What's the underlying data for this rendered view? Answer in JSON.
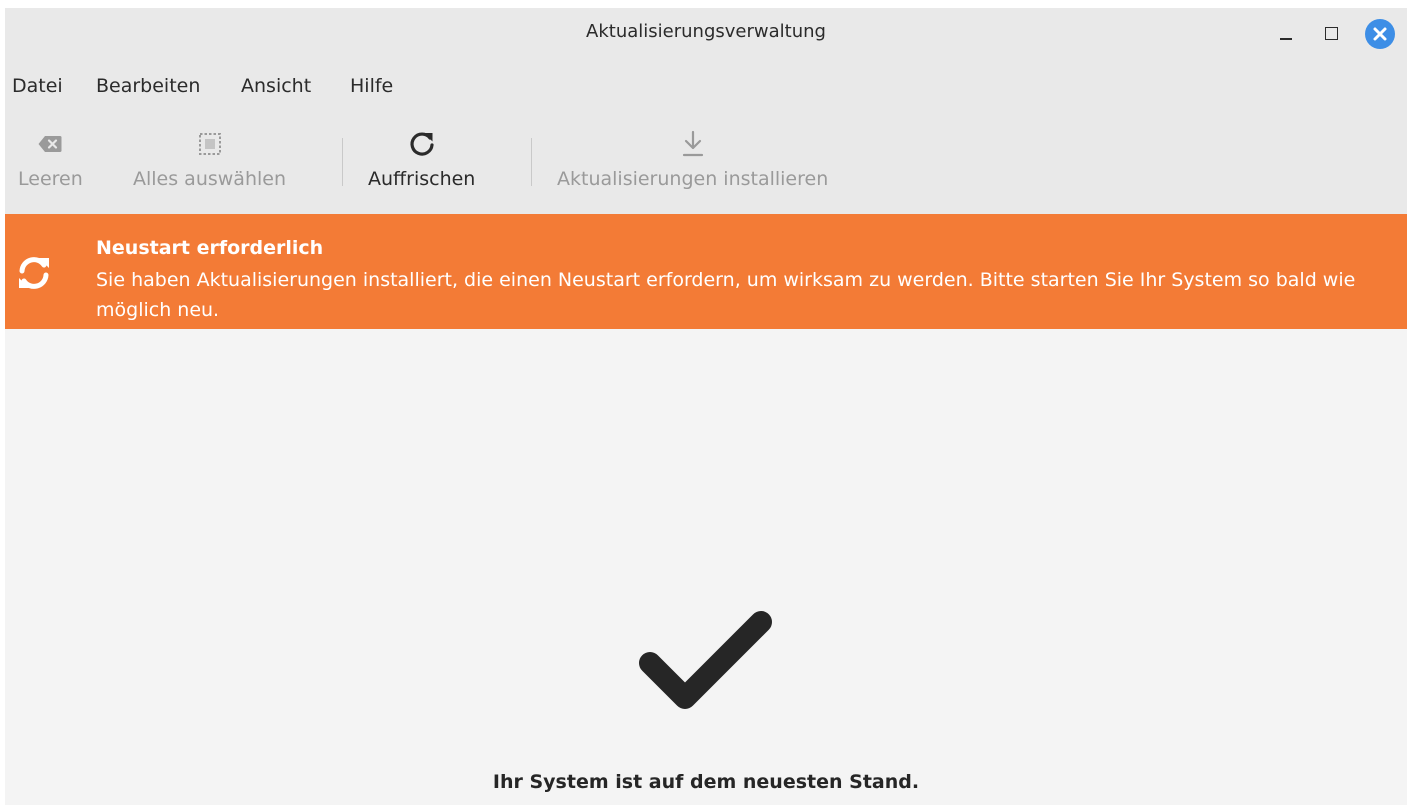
{
  "window": {
    "title": "Aktualisierungsverwaltung"
  },
  "menu": {
    "items": [
      {
        "label": "Datei"
      },
      {
        "label": "Bearbeiten"
      },
      {
        "label": "Ansicht"
      },
      {
        "label": "Hilfe"
      }
    ]
  },
  "toolbar": {
    "clear_label": "Leeren",
    "select_all_label": "Alles auswählen",
    "refresh_label": "Auffrischen",
    "install_label": "Aktualisierungen installieren"
  },
  "banner": {
    "title": "Neustart erforderlich",
    "message": "Sie haben Aktualisierungen installiert, die einen Neustart erfordern, um wirksam zu werden. Bitte starten Sie Ihr System so bald wie möglich neu.",
    "color": "#f37b36",
    "icon": "refresh-icon"
  },
  "main": {
    "status": "Ihr System ist auf dem neuesten Stand.",
    "icon": "checkmark-icon"
  },
  "colors": {
    "accent": "#3d8ee6",
    "warning": "#f37b36"
  }
}
